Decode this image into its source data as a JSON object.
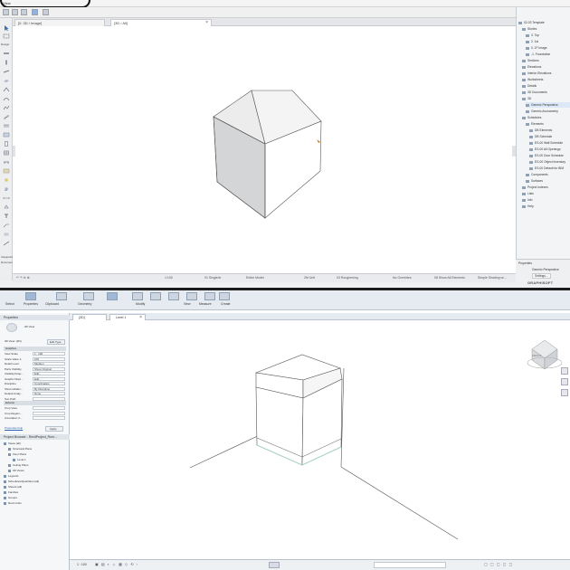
{
  "archicad": {
    "menu": [
      "View"
    ],
    "view_tabs": [
      {
        "label": "[0. 3D / Image]"
      },
      {
        "label": "[3D / All]"
      }
    ],
    "design_label": "Design",
    "toolbox_bottom_labels": [
      "Viewpoint",
      "Document"
    ],
    "navigator": [
      {
        "label": "02-03 Template",
        "indent": 0
      },
      {
        "label": "Stories",
        "indent": 1
      },
      {
        "label": "3. Top",
        "indent": 2
      },
      {
        "label": "2. 1st",
        "indent": 2
      },
      {
        "label": "0. 1F Image",
        "indent": 2
      },
      {
        "label": "-1. Foundation",
        "indent": 2
      },
      {
        "label": "Sections",
        "indent": 1
      },
      {
        "label": "Elevations",
        "indent": 1
      },
      {
        "label": "Interior Elevations",
        "indent": 1
      },
      {
        "label": "Worksheets",
        "indent": 1
      },
      {
        "label": "Details",
        "indent": 1
      },
      {
        "label": "3D Documents",
        "indent": 1
      },
      {
        "label": "3D",
        "indent": 1
      },
      {
        "label": "Generic Perspective",
        "indent": 2,
        "selected": true
      },
      {
        "label": "Generic Axonometry",
        "indent": 2
      },
      {
        "label": "Schedules",
        "indent": 1
      },
      {
        "label": "Elements",
        "indent": 2
      },
      {
        "label": "DB Elements",
        "indent": 3
      },
      {
        "label": "DB Schedule",
        "indent": 3
      },
      {
        "label": "ES-00 Wall Schedule",
        "indent": 3
      },
      {
        "label": "ES-00 All Openings",
        "indent": 3
      },
      {
        "label": "ES-00 Door Schedule",
        "indent": 3
      },
      {
        "label": "ES-00 Object Inventory",
        "indent": 3
      },
      {
        "label": "ES-00 Default for BIM",
        "indent": 3
      },
      {
        "label": "Components",
        "indent": 2
      },
      {
        "label": "Surfaces",
        "indent": 2
      },
      {
        "label": "Project Indexes",
        "indent": 1
      },
      {
        "label": "Lists",
        "indent": 1
      },
      {
        "label": "Info",
        "indent": 1
      },
      {
        "label": "Help",
        "indent": 1
      }
    ],
    "properties": {
      "title": "Properties",
      "view": "Generic Perspective",
      "settings": "Settings..."
    },
    "status_bar": [
      "1:100",
      "01 Single/ie",
      "Entire Model",
      "2M Unit",
      "03 Roughening",
      "No Overrides",
      "08 Show All Elements",
      "Simple Shading w/..."
    ],
    "logo": "GRAPHISOFT"
  },
  "revit": {
    "ribbon_groups": [
      "Select",
      "Properties",
      "Clipboard",
      "Geometry",
      "Modify",
      "View",
      "Measure",
      "Create"
    ],
    "view_tabs": [
      {
        "label": "{3D}"
      },
      {
        "label": "Level 1"
      }
    ],
    "properties": {
      "title": "Properties",
      "type": "3D View",
      "selector": "3D View: {3D}",
      "edit_type": "Edit Type",
      "graphics_group": "Graphics",
      "rows": [
        {
          "label": "View Scale",
          "value": "1 : 100"
        },
        {
          "label": "Scale Value 1:",
          "value": "100"
        },
        {
          "label": "Detail Level",
          "value": "Medium"
        },
        {
          "label": "Parts Visibility",
          "value": "Show Original"
        },
        {
          "label": "Visibility/Grap...",
          "value": "Edit..."
        },
        {
          "label": "Graphic Displ...",
          "value": "Edit..."
        },
        {
          "label": "Discipline",
          "value": "Coordination"
        },
        {
          "label": "Show Hidden...",
          "value": "By Discipline"
        },
        {
          "label": "Default Analy...",
          "value": "None"
        },
        {
          "label": "Sun Path",
          "value": ""
        }
      ],
      "extents_group": "Extents",
      "extents_rows": [
        {
          "label": "Crop View",
          "value": ""
        },
        {
          "label": "Crop Region...",
          "value": ""
        },
        {
          "label": "Annotation C...",
          "value": ""
        }
      ],
      "help_link": "Properties help",
      "apply": "Apply"
    },
    "browser": {
      "title": "Project Browser - RevitProject_Rom...",
      "items": [
        {
          "label": "Views (all)",
          "indent": 0
        },
        {
          "label": "Structural Plans",
          "indent": 1
        },
        {
          "label": "Floor Plans",
          "indent": 1
        },
        {
          "label": "Level 1",
          "indent": 2
        },
        {
          "label": "Ceiling Plans",
          "indent": 1
        },
        {
          "label": "3D Views",
          "indent": 1
        },
        {
          "label": "Legends",
          "indent": 0
        },
        {
          "label": "Schedules/Quantities (all)",
          "indent": 0
        },
        {
          "label": "Sheets (all)",
          "indent": 0
        },
        {
          "label": "Families",
          "indent": 0
        },
        {
          "label": "Groups",
          "indent": 0
        },
        {
          "label": "Revit Links",
          "indent": 0
        }
      ]
    },
    "status_scale": "1 : 100",
    "viewcube_label": "FRONT"
  }
}
